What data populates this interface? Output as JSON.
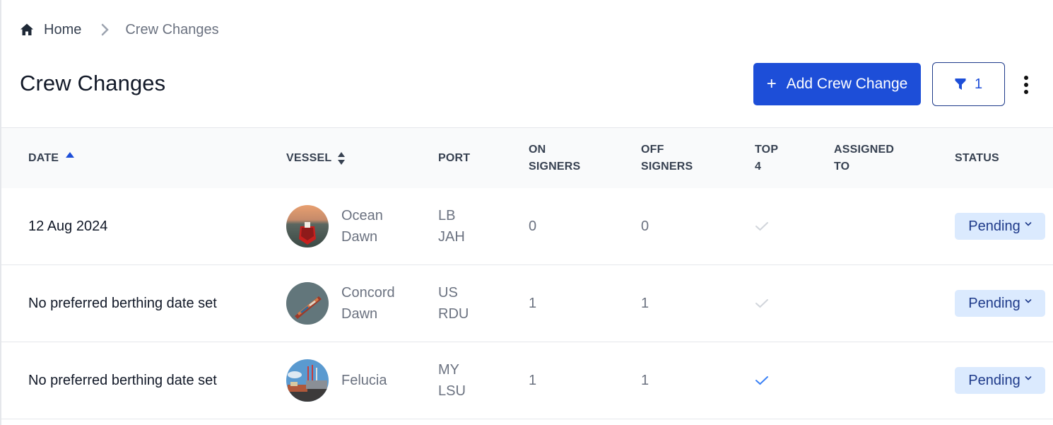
{
  "breadcrumb": {
    "home_icon": "home-icon",
    "home_label": "Home",
    "separator_icon": "chevron-right-icon",
    "current": "Crew Changes"
  },
  "header": {
    "title": "Crew Changes",
    "add_button": {
      "icon": "plus-icon",
      "label": "Add Crew Change"
    },
    "filter_button": {
      "icon": "funnel-icon",
      "count": "1"
    },
    "more_button": {
      "icon": "kebab-menu-icon"
    }
  },
  "colors": {
    "primary": "#1d4ed8",
    "status_bg": "#dbeafe",
    "status_text": "#1e3a8a",
    "check_active": "#3b82f6",
    "check_inactive": "#d1d5db",
    "header_bg": "#f9fafb"
  },
  "table": {
    "columns": [
      {
        "key": "date",
        "label": "DATE",
        "sort": "ascending"
      },
      {
        "key": "vessel",
        "label": "VESSEL",
        "sort": "sortable"
      },
      {
        "key": "port",
        "label": "PORT"
      },
      {
        "key": "on_signers",
        "label_line1": "ON",
        "label_line2": "SIGNERS"
      },
      {
        "key": "off_signers",
        "label_line1": "OFF",
        "label_line2": "SIGNERS"
      },
      {
        "key": "top4",
        "label_line1": "TOP",
        "label_line2": "4"
      },
      {
        "key": "assigned_to",
        "label_line1": "ASSIGNED",
        "label_line2": "TO"
      },
      {
        "key": "status",
        "label": "STATUS"
      }
    ],
    "rows": [
      {
        "date": "12 Aug 2024",
        "vessel_line1": "Ocean",
        "vessel_line2": "Dawn",
        "vessel_image": "tanker-ship-sunset",
        "port_country": "LB",
        "port_code": "JAH",
        "on_signers": "0",
        "off_signers": "0",
        "top4": false,
        "assigned_to": "",
        "status": "Pending"
      },
      {
        "date": "No preferred berthing date set",
        "vessel_line1": "Concord",
        "vessel_line2": "Dawn",
        "vessel_image": "container-ship-aerial",
        "port_country": "US",
        "port_code": "RDU",
        "on_signers": "1",
        "off_signers": "1",
        "top4": false,
        "assigned_to": "",
        "status": "Pending"
      },
      {
        "date": "No preferred berthing date set",
        "vessel_line1": "Felucia",
        "vessel_line2": "",
        "vessel_image": "container-port-cranes",
        "port_country": "MY",
        "port_code": "LSU",
        "on_signers": "1",
        "off_signers": "1",
        "top4": true,
        "assigned_to": "",
        "status": "Pending"
      }
    ]
  }
}
